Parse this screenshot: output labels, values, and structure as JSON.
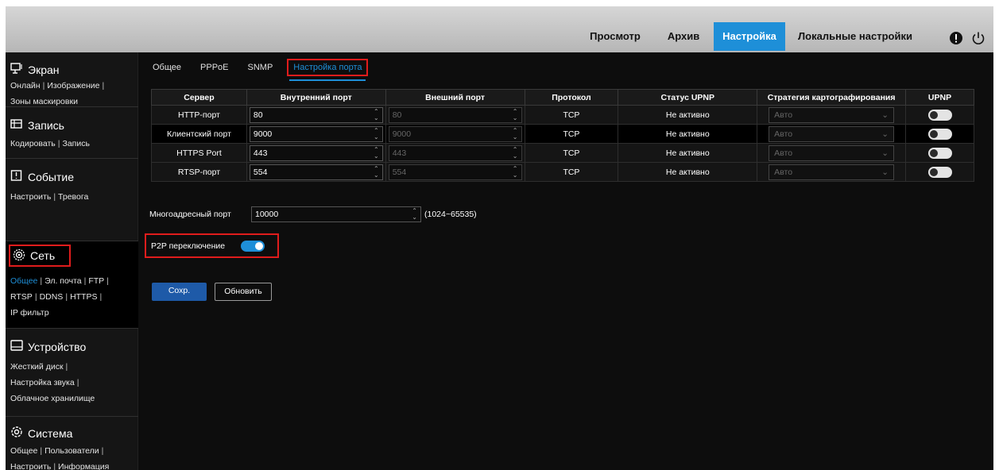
{
  "topnav": {
    "items": [
      {
        "label": "Просмотр"
      },
      {
        "label": "Архив"
      },
      {
        "label": "Настройка",
        "active": true
      },
      {
        "label": "Локальные настройки"
      }
    ],
    "icons": [
      "alert-icon",
      "power-icon"
    ]
  },
  "sidebar": {
    "screen": {
      "title": "Экран",
      "links": [
        "Онлайн",
        "Изображение",
        "Зоны маскировки"
      ]
    },
    "record": {
      "title": "Запись",
      "links": [
        "Кодировать",
        "Запись"
      ]
    },
    "event": {
      "title": "Событие",
      "links": [
        "Настроить",
        "Тревога"
      ]
    },
    "network": {
      "title": "Сеть",
      "links": [
        "Общее",
        "Эл. почта",
        "FTP",
        "RTSP",
        "DDNS",
        "HTTPS",
        "IP фильтр"
      ]
    },
    "device": {
      "title": "Устройство",
      "links": [
        "Жесткий диск",
        "Настройка звука",
        "Облачное хранилище"
      ]
    },
    "system": {
      "title": "Система",
      "links": [
        "Общее",
        "Пользователи",
        "Настроить",
        "Информация"
      ]
    }
  },
  "tabs": [
    "Общее",
    "PPPoE",
    "SNMP",
    "Настройка порта"
  ],
  "table": {
    "headers": [
      "Сервер",
      "Внутренний порт",
      "Внешний порт",
      "Протокол",
      "Статус UPNP",
      "Стратегия картографирования",
      "UPNP"
    ],
    "rows": [
      {
        "server": "HTTP-порт",
        "internal": "80",
        "external": "80",
        "protocol": "TCP",
        "status": "Не активно",
        "strategy": "Авто"
      },
      {
        "server": "Клиентский порт",
        "internal": "9000",
        "external": "9000",
        "protocol": "TCP",
        "status": "Не активно",
        "strategy": "Авто"
      },
      {
        "server": "HTTPS Port",
        "internal": "443",
        "external": "443",
        "protocol": "TCP",
        "status": "Не активно",
        "strategy": "Авто"
      },
      {
        "server": "RTSP-порт",
        "internal": "554",
        "external": "554",
        "protocol": "TCP",
        "status": "Не активно",
        "strategy": "Авто"
      }
    ]
  },
  "multicast": {
    "label": "Многоадресный порт",
    "value": "10000",
    "range": "(1024~65535)"
  },
  "p2p": {
    "label": "P2P переключение",
    "enabled": true
  },
  "buttons": {
    "save": "Сохр.",
    "refresh": "Обновить"
  },
  "colors": {
    "accent": "#1e8fd8",
    "highlight": "#e01c1c"
  }
}
